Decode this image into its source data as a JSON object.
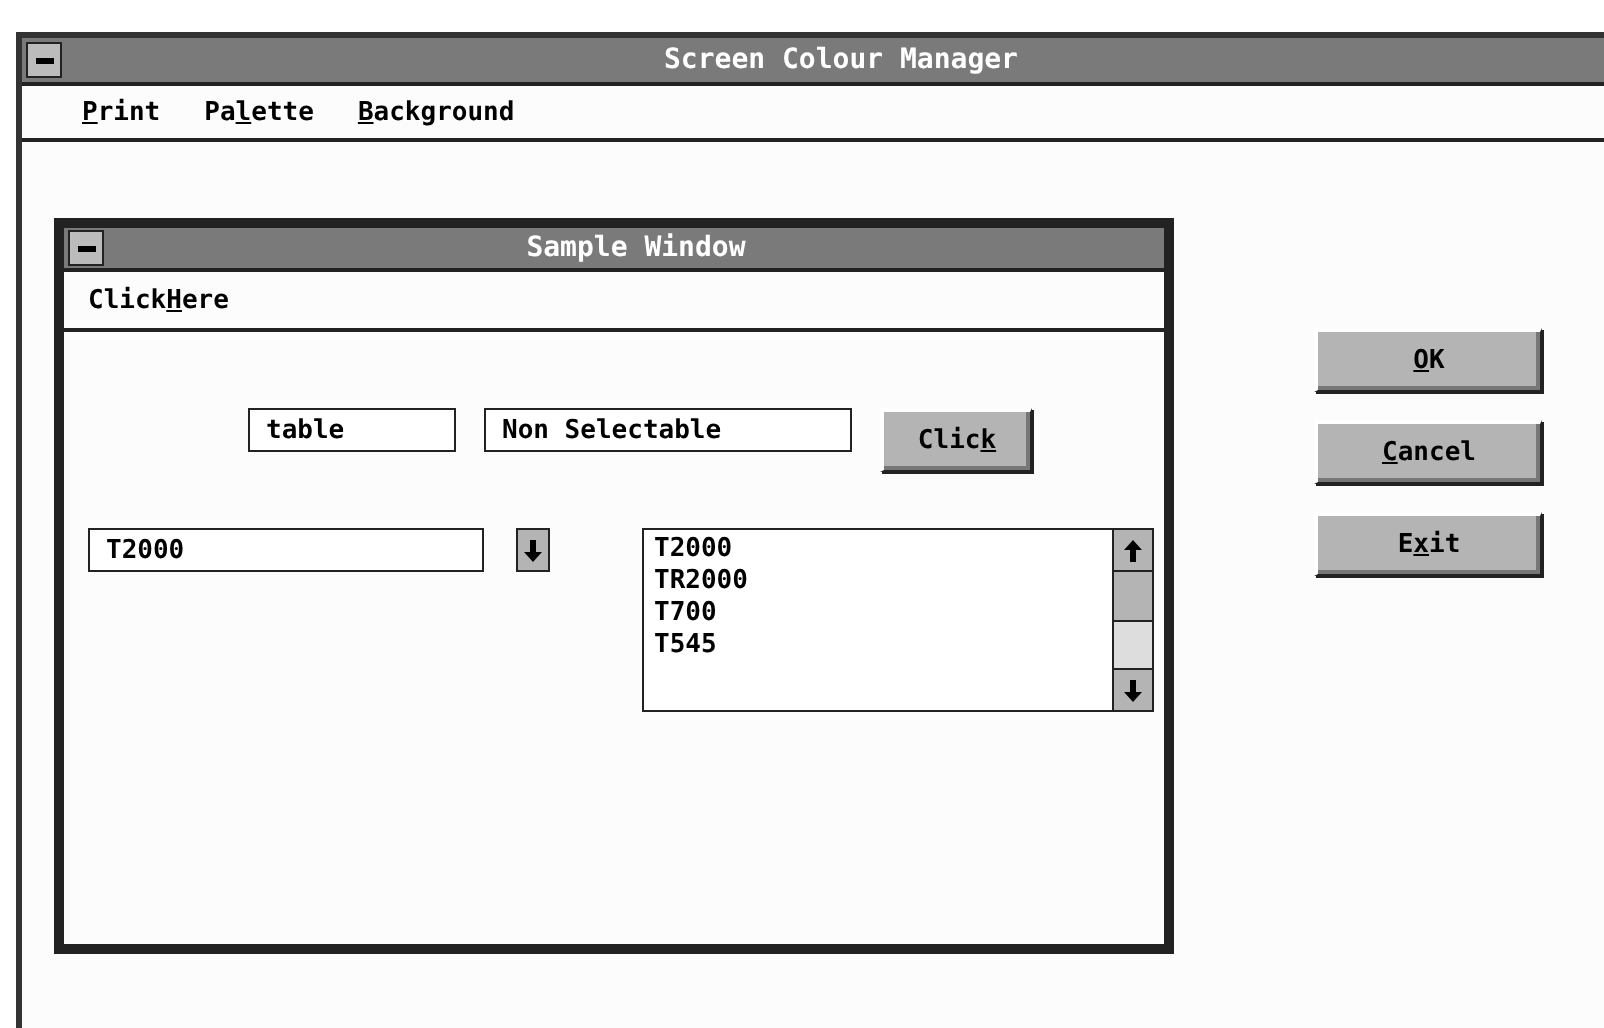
{
  "window": {
    "title": "Screen Colour Manager"
  },
  "menu": [
    {
      "key": "P",
      "after": "rint"
    },
    {
      "before": "Pa",
      "key": "l",
      "after": "ette"
    },
    {
      "key": "B",
      "after": "ackground"
    }
  ],
  "sample_window": {
    "title": "Sample Window",
    "menu": [
      {
        "before": "Click",
        "key": "H",
        "after": "ere"
      }
    ],
    "text_field": {
      "value": "table"
    },
    "static_field": {
      "value": "Non Selectable"
    },
    "button": {
      "before": "Clic",
      "key": "k"
    },
    "combo": {
      "value": "T2000"
    },
    "list": {
      "items": [
        {
          "label": "T2000",
          "selected": false
        },
        {
          "label": "TR2000",
          "selected": false
        },
        {
          "label": "T700",
          "selected": false
        },
        {
          "label": "T545",
          "selected": false
        }
      ]
    }
  },
  "buttons": [
    {
      "key": "O",
      "after": "K"
    },
    {
      "key": "C",
      "after": "ancel"
    },
    {
      "before": "E",
      "key": "x",
      "after": "it"
    }
  ]
}
